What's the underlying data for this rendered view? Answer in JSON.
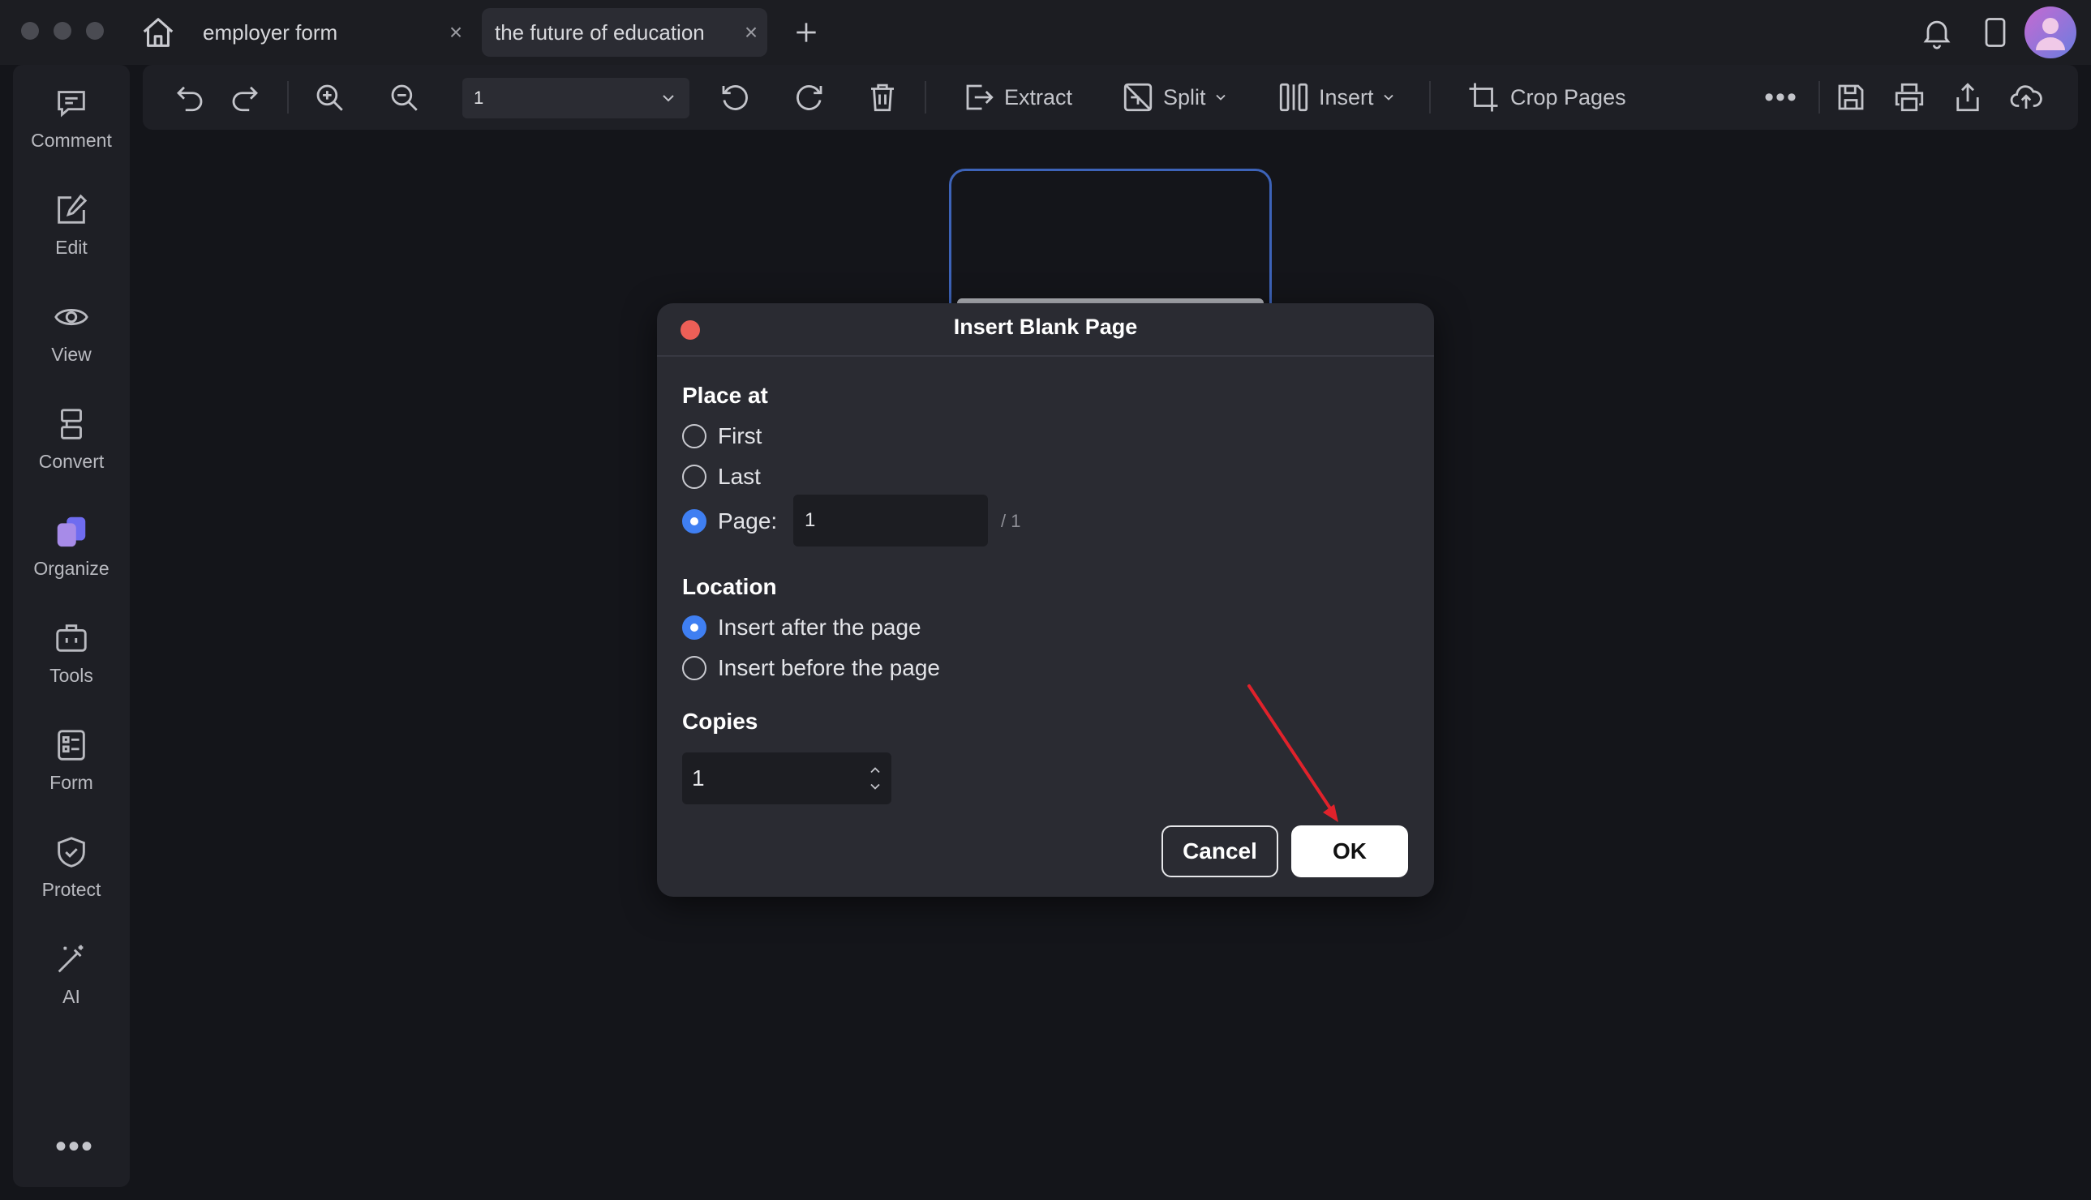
{
  "tabs": [
    {
      "label": "employer form",
      "active": false
    },
    {
      "label": "the future of education",
      "active": true
    }
  ],
  "sidebar": {
    "items": [
      {
        "label": "Comment",
        "icon": "comment-icon"
      },
      {
        "label": "Edit",
        "icon": "edit-icon"
      },
      {
        "label": "View",
        "icon": "eye-icon"
      },
      {
        "label": "Convert",
        "icon": "convert-icon"
      },
      {
        "label": "Organize",
        "icon": "organize-icon",
        "active": true
      },
      {
        "label": "Tools",
        "icon": "toolbox-icon"
      },
      {
        "label": "Form",
        "icon": "form-icon"
      },
      {
        "label": "Protect",
        "icon": "shield-icon"
      },
      {
        "label": "AI",
        "icon": "magic-wand-icon"
      }
    ]
  },
  "toolbar": {
    "page_value": "1",
    "extract_label": "Extract",
    "split_label": "Split",
    "insert_label": "Insert",
    "crop_label": "Crop Pages"
  },
  "dialog": {
    "title": "Insert Blank Page",
    "place_at": {
      "heading": "Place at",
      "first_label": "First",
      "last_label": "Last",
      "page_label": "Page:",
      "page_value": "1",
      "page_total": "/ 1",
      "selected": "page"
    },
    "location": {
      "heading": "Location",
      "after_label": "Insert after the page",
      "before_label": "Insert before the page",
      "selected": "after"
    },
    "copies": {
      "heading": "Copies",
      "value": "1"
    },
    "cancel_label": "Cancel",
    "ok_label": "OK"
  },
  "colors": {
    "accent": "#3f7ff2",
    "annotation_arrow": "#e0222b",
    "close_dot": "#ec5f57"
  }
}
